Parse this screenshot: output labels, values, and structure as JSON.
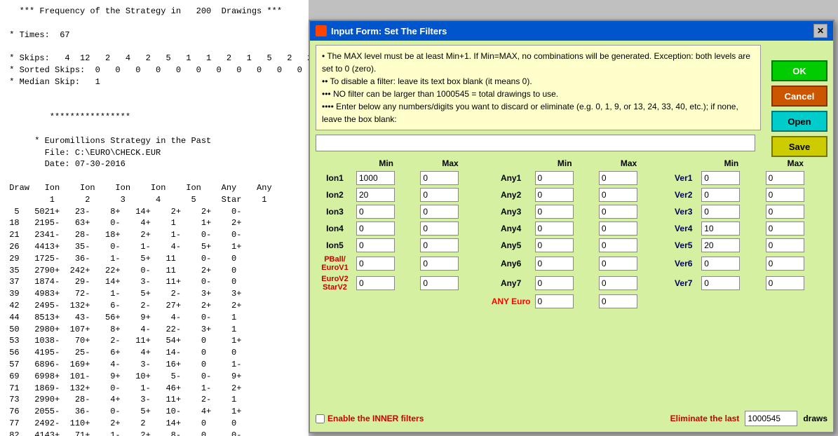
{
  "terminal": {
    "lines": [
      "   *** Frequency of the Strategy in   200  Drawings ***",
      "",
      " * Times:  67",
      "",
      " * Skips:   4  12   2   4   2   5   1   1   2   1   5   2   2",
      " * Sorted Skips:  0   0   0   0   0   0   0   0   0   0   0   0",
      " * Median Skip:   1",
      "",
      "",
      "        ****************",
      "",
      "     * Euromillions Strategy in the Past",
      "       File: C:\\EURO\\CHECK.EUR",
      "       Date: 07-30-2016",
      ""
    ],
    "table_header": "Draw   Ion    Ion    Ion    Ion    Ion    Any    Any",
    "table_header2": "       1      2      3      4      5     Star    1",
    "rows": [
      "  5   5021+   23-    8+   14+    2+    2+    0-",
      " 18   2195-   63+    0-    4+    1     1+    2+",
      " 21   2341-   28-   18+    2+    1-    0-    0-",
      " 26   4413+   35-    0-    1-    4-    5+    1+",
      " 29   1725-   36-    1-    5+   11     0-    0",
      " 35   2790+  242+   22+    0-   11     2+    0",
      " 37   1874-   29-   14+    3-   11+    0-    0",
      " 39   4983+   72-    1-    5+    2-    3+    3+",
      " 42   2495-  132+    6-    2-   27+    2+    2+",
      " 44   8513+   43-   56+    9+    4-    0-    1",
      " 50   2980+  107+    8+    4-   22-    3+    1",
      " 53   1038-   70+    2-   11+   54+    0     1+",
      " 56   4195-   25-    6+    4+   14-    0     0",
      " 57   6896-  169+    4-    3-   16+    0     1-",
      " 69   6998+  101-    9+   10+    5-    0-    9+",
      " 71   1869-  132+    0-    1-   46+    1-    2+",
      " 73   2990+   28-    4+    3-   11+    2-    1",
      " 76   2055-   36-    0-    5+   10-    4+    1+",
      " 77   2492-  110+    2+    2    14+    0     0",
      " 82   4143+   71+    1-    2+    8-    0     0-"
    ]
  },
  "modal": {
    "title": "Input Form: Set The Filters",
    "title_icon": "🎰",
    "close_label": "✕",
    "info_lines": [
      "• The MAX level must be at least Min+1. If Min=MAX, no combinations will be generated.  Exception: both levels are set to 0 (zero).",
      "•• To disable a filter: leave its text box blank (it means 0).",
      "••• NO filter can be larger than 1000545 = total drawings to use.",
      "•••• Enter below any numbers/digits you want to discard or eliminate  (e.g.  0, 1, 9, or 13, 24, 33, 40, etc.);  if none, leave the box blank:"
    ],
    "buttons": {
      "ok": "OK",
      "cancel": "Cancel",
      "open": "Open",
      "save": "Save"
    },
    "col_headers": {
      "min": "Min",
      "max": "Max"
    },
    "filters": {
      "ion1": {
        "label": "Ion1",
        "min": "1000",
        "max": "0"
      },
      "ion2": {
        "label": "Ion2",
        "min": "20",
        "max": "0"
      },
      "ion3": {
        "label": "Ion3",
        "min": "0",
        "max": "0"
      },
      "ion4": {
        "label": "Ion4",
        "min": "0",
        "max": "0"
      },
      "ion5": {
        "label": "Ion5",
        "min": "0",
        "max": "0"
      },
      "pball": {
        "label": "PBall/ EuroV1",
        "min": "0",
        "max": "0"
      },
      "eurov2": {
        "label": "EuroV2 StarV2",
        "min": "0",
        "max": "0"
      },
      "any1": {
        "label": "Any1",
        "min": "0",
        "max": "0"
      },
      "any2": {
        "label": "Any2",
        "min": "0",
        "max": "0"
      },
      "any3": {
        "label": "Any3",
        "min": "0",
        "max": "0"
      },
      "any4": {
        "label": "Any4",
        "min": "0",
        "max": "0"
      },
      "any5": {
        "label": "Any5",
        "min": "0",
        "max": "0"
      },
      "any6": {
        "label": "Any6",
        "min": "0",
        "max": "0"
      },
      "any7": {
        "label": "Any7",
        "min": "0",
        "max": "0"
      },
      "any_euro": {
        "label": "ANY Euro",
        "min": "0",
        "max": "0"
      },
      "ver1": {
        "label": "Ver1",
        "min": "0",
        "max": "0"
      },
      "ver2": {
        "label": "Ver2",
        "min": "0",
        "max": "0"
      },
      "ver3": {
        "label": "Ver3",
        "min": "0",
        "max": "0"
      },
      "ver4": {
        "label": "Ver4",
        "min": "10",
        "max": "0"
      },
      "ver5": {
        "label": "Ver5",
        "min": "20",
        "max": "0"
      },
      "ver6": {
        "label": "Ver6",
        "min": "0",
        "max": "0"
      },
      "ver7": {
        "label": "Ver7",
        "min": "0",
        "max": "0"
      }
    },
    "bottom": {
      "enable_inner_label": "Enable the INNER filters",
      "eliminate_label": "Eliminate the last",
      "eliminate_value": "1000545",
      "draws_label": "draws"
    }
  }
}
